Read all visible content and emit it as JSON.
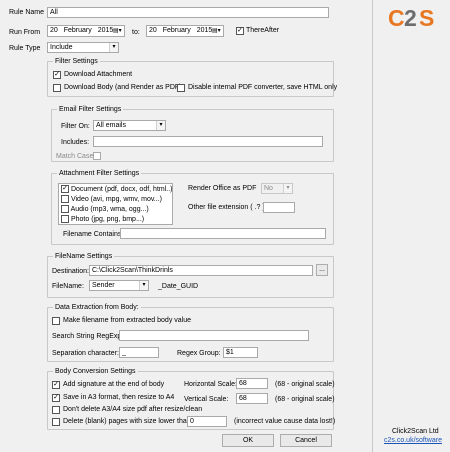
{
  "rule": {
    "name_label": "Rule Name",
    "name_value": "All",
    "run_from_label": "Run From",
    "from_day": "20",
    "from_month": "February",
    "from_year": "2015",
    "to_label": "to:",
    "to_day": "20",
    "to_month": "February",
    "to_year": "2015",
    "thereafter_label": "ThereAfter",
    "type_label": "Rule Type",
    "type_value": "Include"
  },
  "logo": {
    "text": "C2S",
    "color": "#e87722",
    "company": "Click2Scan Ltd",
    "url": "c2s.co.uk/software"
  },
  "filter": {
    "title": "Filter Settings",
    "download_attachment": "Download Attachment",
    "download_body": "Download Body (and Render as PDF)",
    "disable_pdf": "Disable internal PDF converter, save HTML only"
  },
  "email_filter": {
    "title": "Email Filter Settings",
    "filter_on_label": "Filter On:",
    "filter_on_value": "All emails",
    "includes_label": "Includes:",
    "match_case_label": "Match Case"
  },
  "attachment_filter": {
    "title": "Attachment Filter Settings",
    "types": [
      "Document (pdf, docx, odf, html..)",
      "Video (avi, mpg, wmv, mov...)",
      "Audio (mp3, wma, ogg...)",
      "Photo (jpg, png, bmp...)"
    ],
    "render_office_label": "Render Office as PDF",
    "render_office_value": "No",
    "other_ext_label": "Other file extension ( .? )",
    "filename_contains_label": "Filename Contains:"
  },
  "filename": {
    "title": "FileName Settings",
    "destination_label": "Destination:",
    "destination_value": "C:\\Click2Scan\\ThinkDrinls",
    "browse_label": "...",
    "filename_label": "FileName:",
    "filename_value": "Sender",
    "suffix": "_Date_GUID"
  },
  "extraction": {
    "title": "Data Extraction from Body:",
    "make_filename_label": "Make filename from extracted body value",
    "search_label": "Search String RegExp:",
    "separation_label": "Separation character:",
    "separation_value": "_",
    "regex_group_label": "Regex Group:",
    "regex_group_value": "$1"
  },
  "conversion": {
    "title": "Body Conversion Settings",
    "add_signature_label": "Add signature at the end of body",
    "save_a3_label": "Save in A3 format, then resize to A4",
    "dont_delete_label": "Don't delete A3/A4 size pdf after resize/clean",
    "delete_blank_label": "Delete (blank) pages with size lower than:",
    "delete_blank_value": "0",
    "delete_blank_note": "(incorrect value cause data lost!)",
    "horizontal_label": "Horizontal Scale:",
    "horizontal_value": "68",
    "horizontal_note": "(68 - original scale)",
    "vertical_label": "Vertical Scale:",
    "vertical_value": "68",
    "vertical_note": "(68 - original scale)"
  },
  "buttons": {
    "ok": "OK",
    "cancel": "Cancel"
  },
  "icons": {
    "calendar": "calendar-icon",
    "dropdown": "chevron-down-icon",
    "check": "check-icon"
  }
}
